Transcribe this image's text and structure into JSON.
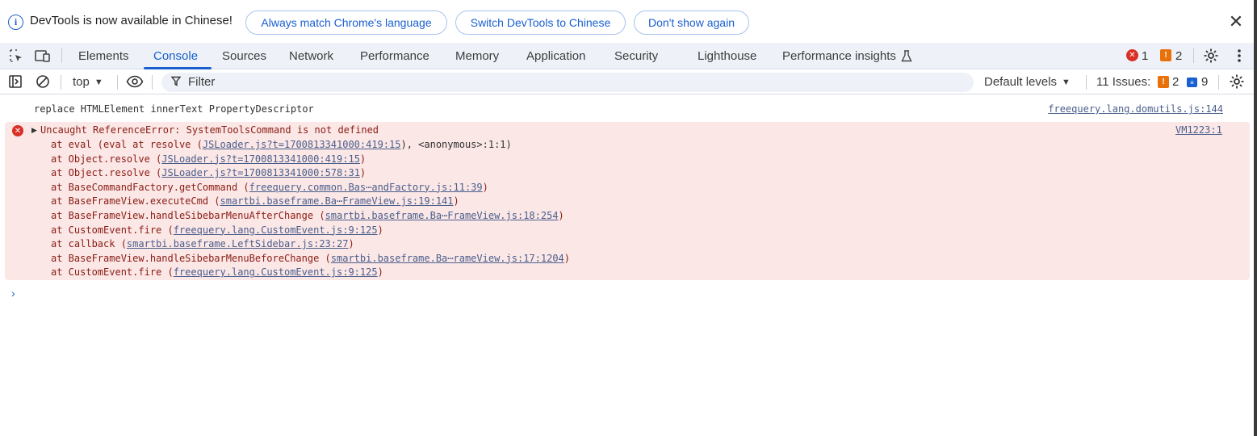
{
  "infobar": {
    "message": "DevTools is now available in Chinese!",
    "btn_match": "Always match Chrome's language",
    "btn_switch": "Switch DevTools to Chinese",
    "btn_dismiss": "Don't show again",
    "close_glyph": "✕"
  },
  "tabs": [
    {
      "label": "Elements"
    },
    {
      "label": "Console"
    },
    {
      "label": "Sources"
    },
    {
      "label": "Network"
    },
    {
      "label": "Performance"
    },
    {
      "label": "Memory"
    },
    {
      "label": "Application"
    },
    {
      "label": "Security"
    },
    {
      "label": "Lighthouse"
    },
    {
      "label": "Performance insights"
    }
  ],
  "status": {
    "errors": "1",
    "warnings": "2"
  },
  "toolbar": {
    "context": "top",
    "filter_placeholder": "Filter",
    "levels": "Default levels",
    "issues_label": "11 Issues:",
    "issues_warn": "2",
    "issues_info": "9"
  },
  "console": {
    "log": {
      "text": "replace HTMLElement innerText PropertyDescriptor",
      "source": "freequery.lang.domutils.js:144"
    },
    "error": {
      "message": "Uncaught ReferenceError: SystemToolsCommand is not defined",
      "source": "VM1223:1",
      "stack": [
        {
          "prefix": "at eval (eval at resolve (",
          "link": "JSLoader.js?t=1700813341000:419:15",
          "suffix": "), <anonymous>:1:1)"
        },
        {
          "prefix": "at Object.resolve (",
          "link": "JSLoader.js?t=1700813341000:419:15",
          "suffix": ")"
        },
        {
          "prefix": "at Object.resolve (",
          "link": "JSLoader.js?t=1700813341000:578:31",
          "suffix": ")"
        },
        {
          "prefix": "at BaseCommandFactory.getCommand (",
          "link": "freequery.common.Bas⋯andFactory.js:11:39",
          "suffix": ")"
        },
        {
          "prefix": "at BaseFrameView.executeCmd (",
          "link": "smartbi.baseframe.Ba⋯FrameView.js:19:141",
          "suffix": ")"
        },
        {
          "prefix": "at BaseFrameView.handleSibebarMenuAfterChange (",
          "link": "smartbi.baseframe.Ba⋯FrameView.js:18:254",
          "suffix": ")"
        },
        {
          "prefix": "at CustomEvent.fire (",
          "link": "freequery.lang.CustomEvent.js:9:125",
          "suffix": ")"
        },
        {
          "prefix": "at callback (",
          "link": "smartbi.baseframe.LeftSidebar.js:23:27",
          "suffix": ")"
        },
        {
          "prefix": "at BaseFrameView.handleSibebarMenuBeforeChange (",
          "link": "smartbi.baseframe.Ba⋯rameView.js:17:1204",
          "suffix": ")"
        },
        {
          "prefix": "at CustomEvent.fire (",
          "link": "freequery.lang.CustomEvent.js:9:125",
          "suffix": ")"
        }
      ]
    },
    "prompt_glyph": "›"
  },
  "colors": {
    "accent": "#1a5fd0",
    "error": "#d93025",
    "warning": "#e8710a",
    "error_bg": "#fbe7e6"
  }
}
